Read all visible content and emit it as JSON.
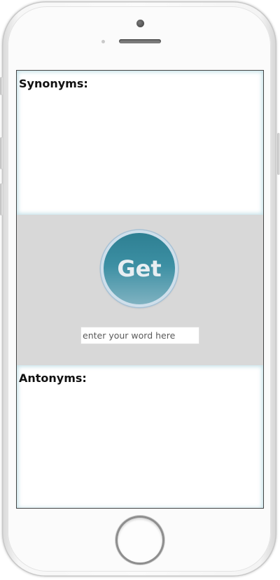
{
  "panels": {
    "synonyms_label": "Synonyms:",
    "antonyms_label": "Antonyms:"
  },
  "controls": {
    "get_button_label": "Get",
    "word_input_placeholder": "enter your word here",
    "word_input_value": ""
  },
  "colors": {
    "accent": "#3a8ca0",
    "middle_background": "#d8d8d8"
  }
}
